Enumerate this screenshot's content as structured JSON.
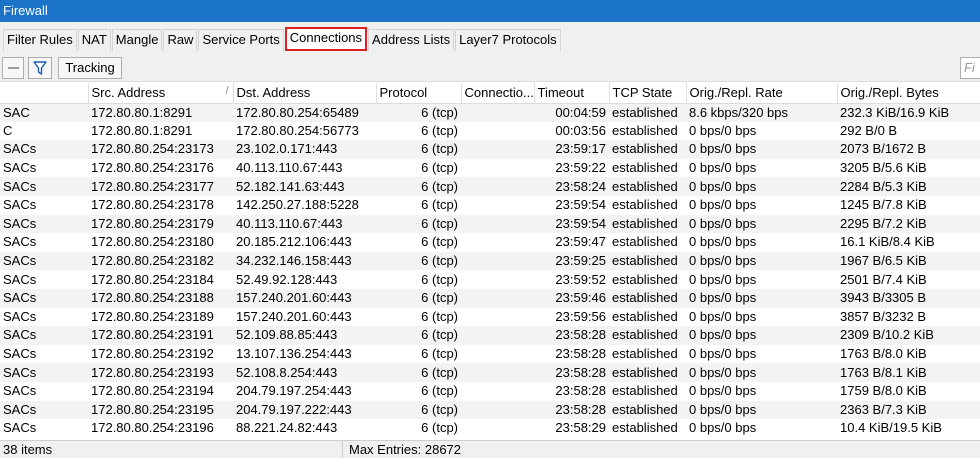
{
  "window": {
    "title": "Firewall"
  },
  "tabs": [
    {
      "label": "Filter Rules",
      "active": false
    },
    {
      "label": "NAT",
      "active": false
    },
    {
      "label": "Mangle",
      "active": false
    },
    {
      "label": "Raw",
      "active": false
    },
    {
      "label": "Service Ports",
      "active": false
    },
    {
      "label": "Connections",
      "active": true
    },
    {
      "label": "Address Lists",
      "active": false
    },
    {
      "label": "Layer7 Protocols",
      "active": false
    }
  ],
  "toolbar": {
    "tracking_label": "Tracking",
    "find_placeholder": "Fi"
  },
  "table": {
    "columns": [
      "",
      "Src. Address",
      "Dst. Address",
      "Protocol",
      "Connectio...",
      "Timeout",
      "TCP State",
      "Orig./Repl. Rate",
      "Orig./Repl. Bytes"
    ],
    "sort_indicator": "/",
    "rows": [
      [
        "SAC",
        "172.80.80.1:8291",
        "172.80.80.254:65489",
        "6 (tcp)",
        "",
        "00:04:59",
        "established",
        "8.6 kbps/320 bps",
        "232.3 KiB/16.9 KiB"
      ],
      [
        "C",
        "172.80.80.1:8291",
        "172.80.80.254:56773",
        "6 (tcp)",
        "",
        "00:03:56",
        "established",
        "0 bps/0 bps",
        "292 B/0 B"
      ],
      [
        "SACs",
        "172.80.80.254:23173",
        "23.102.0.171:443",
        "6 (tcp)",
        "",
        "23:59:17",
        "established",
        "0 bps/0 bps",
        "2073 B/1672 B"
      ],
      [
        "SACs",
        "172.80.80.254:23176",
        "40.113.110.67:443",
        "6 (tcp)",
        "",
        "23:59:22",
        "established",
        "0 bps/0 bps",
        "3205 B/5.6 KiB"
      ],
      [
        "SACs",
        "172.80.80.254:23177",
        "52.182.141.63:443",
        "6 (tcp)",
        "",
        "23:58:24",
        "established",
        "0 bps/0 bps",
        "2284 B/5.3 KiB"
      ],
      [
        "SACs",
        "172.80.80.254:23178",
        "142.250.27.188:5228",
        "6 (tcp)",
        "",
        "23:59:54",
        "established",
        "0 bps/0 bps",
        "1245 B/7.8 KiB"
      ],
      [
        "SACs",
        "172.80.80.254:23179",
        "40.113.110.67:443",
        "6 (tcp)",
        "",
        "23:59:54",
        "established",
        "0 bps/0 bps",
        "2295 B/7.2 KiB"
      ],
      [
        "SACs",
        "172.80.80.254:23180",
        "20.185.212.106:443",
        "6 (tcp)",
        "",
        "23:59:47",
        "established",
        "0 bps/0 bps",
        "16.1 KiB/8.4 KiB"
      ],
      [
        "SACs",
        "172.80.80.254:23182",
        "34.232.146.158:443",
        "6 (tcp)",
        "",
        "23:59:25",
        "established",
        "0 bps/0 bps",
        "1967 B/6.5 KiB"
      ],
      [
        "SACs",
        "172.80.80.254:23184",
        "52.49.92.128:443",
        "6 (tcp)",
        "",
        "23:59:52",
        "established",
        "0 bps/0 bps",
        "2501 B/7.4 KiB"
      ],
      [
        "SACs",
        "172.80.80.254:23188",
        "157.240.201.60:443",
        "6 (tcp)",
        "",
        "23:59:46",
        "established",
        "0 bps/0 bps",
        "3943 B/3305 B"
      ],
      [
        "SACs",
        "172.80.80.254:23189",
        "157.240.201.60:443",
        "6 (tcp)",
        "",
        "23:59:56",
        "established",
        "0 bps/0 bps",
        "3857 B/3232 B"
      ],
      [
        "SACs",
        "172.80.80.254:23191",
        "52.109.88.85:443",
        "6 (tcp)",
        "",
        "23:58:28",
        "established",
        "0 bps/0 bps",
        "2309 B/10.2 KiB"
      ],
      [
        "SACs",
        "172.80.80.254:23192",
        "13.107.136.254:443",
        "6 (tcp)",
        "",
        "23:58:28",
        "established",
        "0 bps/0 bps",
        "1763 B/8.0 KiB"
      ],
      [
        "SACs",
        "172.80.80.254:23193",
        "52.108.8.254:443",
        "6 (tcp)",
        "",
        "23:58:28",
        "established",
        "0 bps/0 bps",
        "1763 B/8.1 KiB"
      ],
      [
        "SACs",
        "172.80.80.254:23194",
        "204.79.197.254:443",
        "6 (tcp)",
        "",
        "23:58:28",
        "established",
        "0 bps/0 bps",
        "1759 B/8.0 KiB"
      ],
      [
        "SACs",
        "172.80.80.254:23195",
        "204.79.197.222:443",
        "6 (tcp)",
        "",
        "23:58:28",
        "established",
        "0 bps/0 bps",
        "2363 B/7.3 KiB"
      ],
      [
        "SACs",
        "172.80.80.254:23196",
        "88.221.24.82:443",
        "6 (tcp)",
        "",
        "23:58:29",
        "established",
        "0 bps/0 bps",
        "10.4 KiB/19.5 KiB"
      ]
    ]
  },
  "status": {
    "count": "38 items",
    "max_entries": "Max Entries: 28672"
  },
  "colors": {
    "titlebar": "#1a73c8",
    "active_tab_border": "#e0201d",
    "row_stripe": "#f3f3f3"
  }
}
